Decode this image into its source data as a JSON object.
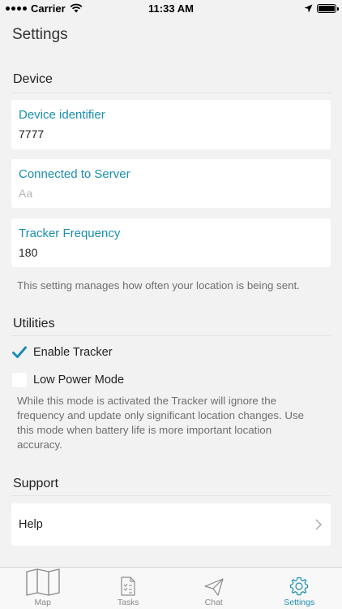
{
  "status_bar": {
    "carrier": "Carrier",
    "time": "11:33 AM"
  },
  "page": {
    "title": "Settings"
  },
  "device": {
    "header": "Device",
    "identifier": {
      "label": "Device identifier",
      "value": "7777"
    },
    "server": {
      "label": "Connected to Server",
      "placeholder": "Aa"
    },
    "frequency": {
      "label": "Tracker Frequency",
      "value": "180"
    },
    "hint": "This setting manages how often your location is being sent."
  },
  "utilities": {
    "header": "Utilities",
    "enable_tracker": {
      "label": "Enable Tracker",
      "checked": true
    },
    "low_power": {
      "label": "Low Power Mode",
      "checked": false
    },
    "hint": "While this mode is activated the Tracker will ignore the frequency and update only significant location changes. Use this mode when battery life is more important location accuracy."
  },
  "support": {
    "header": "Support",
    "help_label": "Help"
  },
  "tabbar": {
    "tabs": [
      {
        "label": "Map",
        "icon": "map-icon",
        "active": false
      },
      {
        "label": "Tasks",
        "icon": "tasks-icon",
        "active": false
      },
      {
        "label": "Chat",
        "icon": "send-icon",
        "active": false
      },
      {
        "label": "Settings",
        "icon": "gear-icon",
        "active": true
      }
    ]
  },
  "colors": {
    "accent": "#1a8fb0",
    "background": "#f2f2f2",
    "card": "#ffffff",
    "hint_text": "#6f6f6f"
  }
}
